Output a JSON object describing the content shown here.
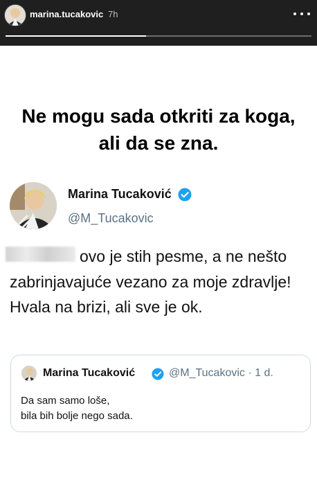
{
  "story": {
    "username": "marina.tucakovic",
    "time": "7h",
    "progress": 0.46
  },
  "headline": {
    "text": "Ne mogu sada otkriti za koga, ali da se zna."
  },
  "tweet": {
    "name": "Marina Tucaković",
    "handle": "@M_Tucakovic",
    "body": "ovo je stih pesme, a ne nešto zabrinjavajuće vezano za moje zdravlje! Hvala na brizi, ali sve je ok."
  },
  "quoted_tweet": {
    "name": "Marina Tucaković",
    "handle_time": "@M_Tucakovic · 1 d.",
    "lines": [
      "Da sam samo loše,",
      "bila bih bolje nego sada."
    ]
  },
  "colors": {
    "story_bar": "#1f1f1f",
    "verified_blue": "#1da1f2",
    "handle_gray": "#5b7083"
  }
}
